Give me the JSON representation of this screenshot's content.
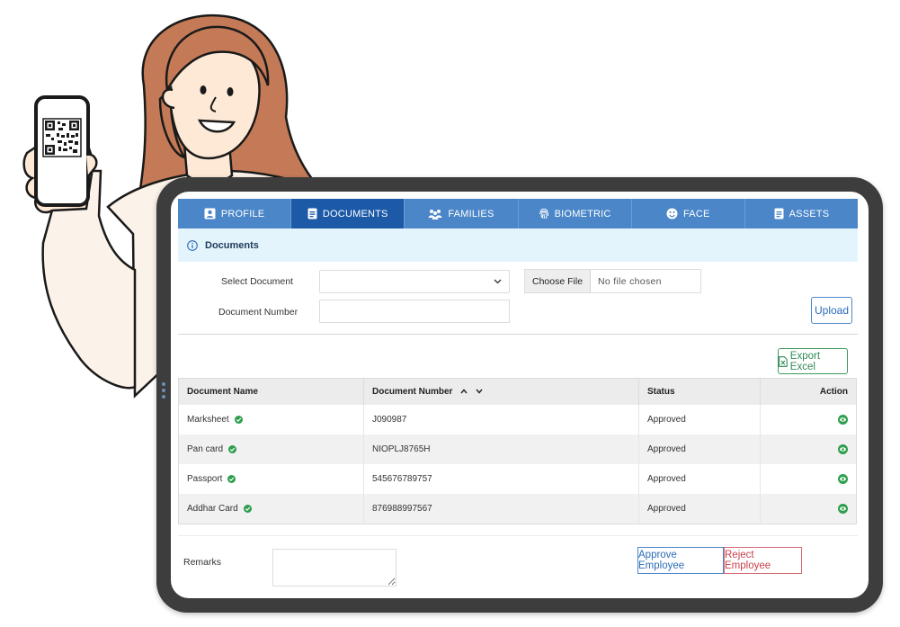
{
  "colors": {
    "tab_bar": "#4a86c8",
    "tab_active": "#1c5aa8",
    "info_bg": "#e4f4fc",
    "approved_green": "#2e9e4e",
    "reject_red": "#c9404b"
  },
  "tabs": [
    {
      "label": "PROFILE",
      "icon": "profile-icon"
    },
    {
      "label": "DOCUMENTS",
      "icon": "document-icon"
    },
    {
      "label": "FAMILIES",
      "icon": "family-icon"
    },
    {
      "label": "BIOMETRIC",
      "icon": "fingerprint-icon"
    },
    {
      "label": "FACE",
      "icon": "face-icon"
    },
    {
      "label": "ASSETS",
      "icon": "assets-icon"
    }
  ],
  "active_tab": "DOCUMENTS",
  "section": {
    "title": "Documents",
    "icon": "info-icon"
  },
  "form": {
    "select_label": "Select Document",
    "select_value": "",
    "number_label": "Document Number",
    "number_value": "",
    "choose_file_label": "Choose File",
    "file_status": "No file chosen",
    "upload_label": "Upload"
  },
  "export_label": "Export Excel",
  "table": {
    "headers": [
      "Document Name",
      "Document Number",
      "Status",
      "Action"
    ],
    "rows": [
      {
        "name": "Marksheet",
        "number": "J090987",
        "status": "Approved"
      },
      {
        "name": "Pan card",
        "number": "NIOPLJ8765H",
        "status": "Approved"
      },
      {
        "name": "Passport",
        "number": "545676789757",
        "status": "Approved"
      },
      {
        "name": "Addhar Card",
        "number": "876988997567",
        "status": "Approved"
      }
    ]
  },
  "remarks": {
    "label": "Remarks",
    "value": ""
  },
  "actions": {
    "approve_label": "Approve Employee",
    "reject_label": "Reject Employee"
  }
}
